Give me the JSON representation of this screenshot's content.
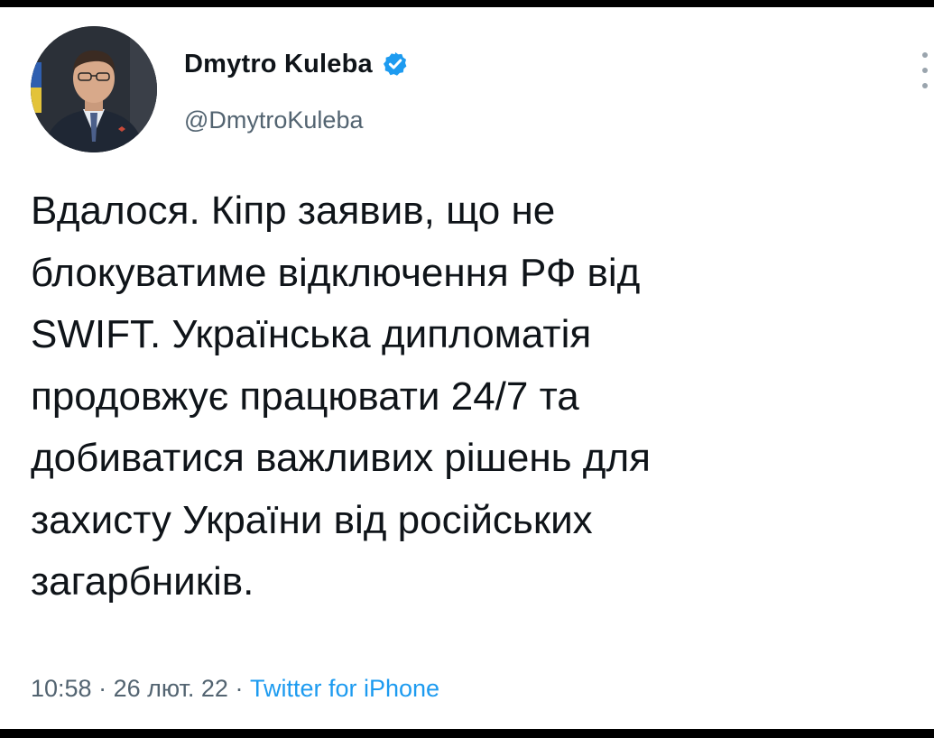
{
  "tweet": {
    "author": {
      "display_name": "Dmytro Kuleba",
      "handle": "@DmytroKuleba",
      "verified": true
    },
    "text_lines": [
      "Вдалося. Кіпр заявив, що не",
      "блокуватиме відключення РФ від",
      "SWIFT. Українська дипломатія",
      "продовжує працювати 24/7 та",
      "добиватися важливих рішень для",
      "захисту України від російських",
      "загарбників."
    ],
    "time": "10:58",
    "date": "26 лют. 22",
    "separator": " · ",
    "source": "Twitter for iPhone"
  },
  "colors": {
    "text": "#0f1419",
    "secondary": "#536471",
    "accent": "#1d9bf0"
  },
  "icons": {
    "verified": "verified-badge-icon",
    "more": "more-options-icon"
  }
}
